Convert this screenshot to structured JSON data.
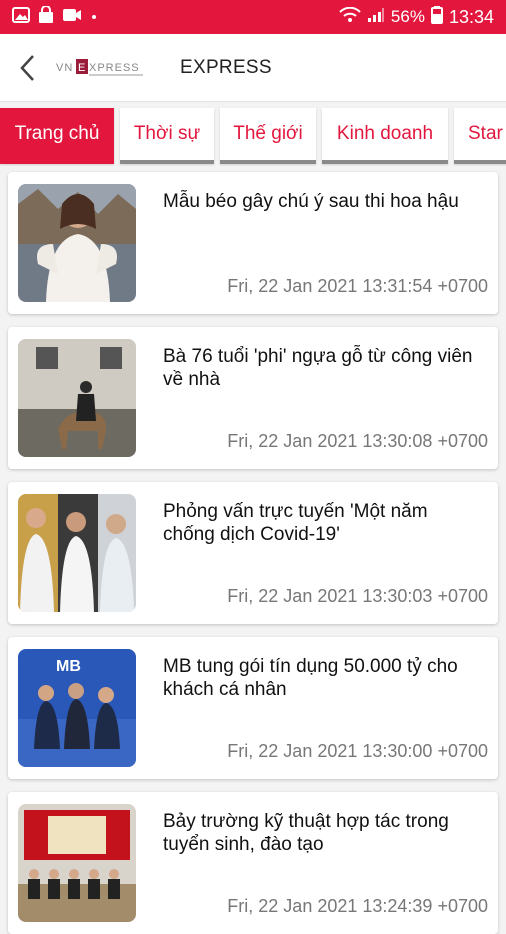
{
  "status_bar": {
    "battery": "56%",
    "time": "13:34",
    "icons": [
      "image-icon",
      "bag-icon",
      "video-icon",
      "dot-icon",
      "wifi-icon",
      "signal-icon",
      "battery-icon"
    ]
  },
  "app_bar": {
    "title": "EXPRESS",
    "logo_text": "VNEXPRESS"
  },
  "tabs": [
    {
      "label": "Trang chủ",
      "active": true
    },
    {
      "label": "Thời sự"
    },
    {
      "label": "Thế giới"
    },
    {
      "label": "Kinh doanh"
    },
    {
      "label": "Star"
    }
  ],
  "articles": [
    {
      "title": "Mẫu béo gây chú ý sau thi hoa hậu",
      "date": "Fri, 22 Jan 2021 13:31:54 +0700"
    },
    {
      "title": "Bà 76 tuổi 'phi' ngựa gỗ từ công viên về nhà",
      "date": "Fri, 22 Jan 2021 13:30:08 +0700"
    },
    {
      "title": "Phỏng vấn trực tuyến 'Một năm chống dịch Covid-19'",
      "date": "Fri, 22 Jan 2021 13:30:03 +0700"
    },
    {
      "title": "MB tung gói tín dụng 50.000 tỷ cho khách cá nhân",
      "date": "Fri, 22 Jan 2021 13:30:00 +0700"
    },
    {
      "title": "Bảy trường kỹ thuật hợp tác trong tuyển sinh, đào tạo",
      "date": "Fri, 22 Jan 2021 13:24:39 +0700"
    }
  ],
  "colors": {
    "accent": "#e3173e"
  }
}
